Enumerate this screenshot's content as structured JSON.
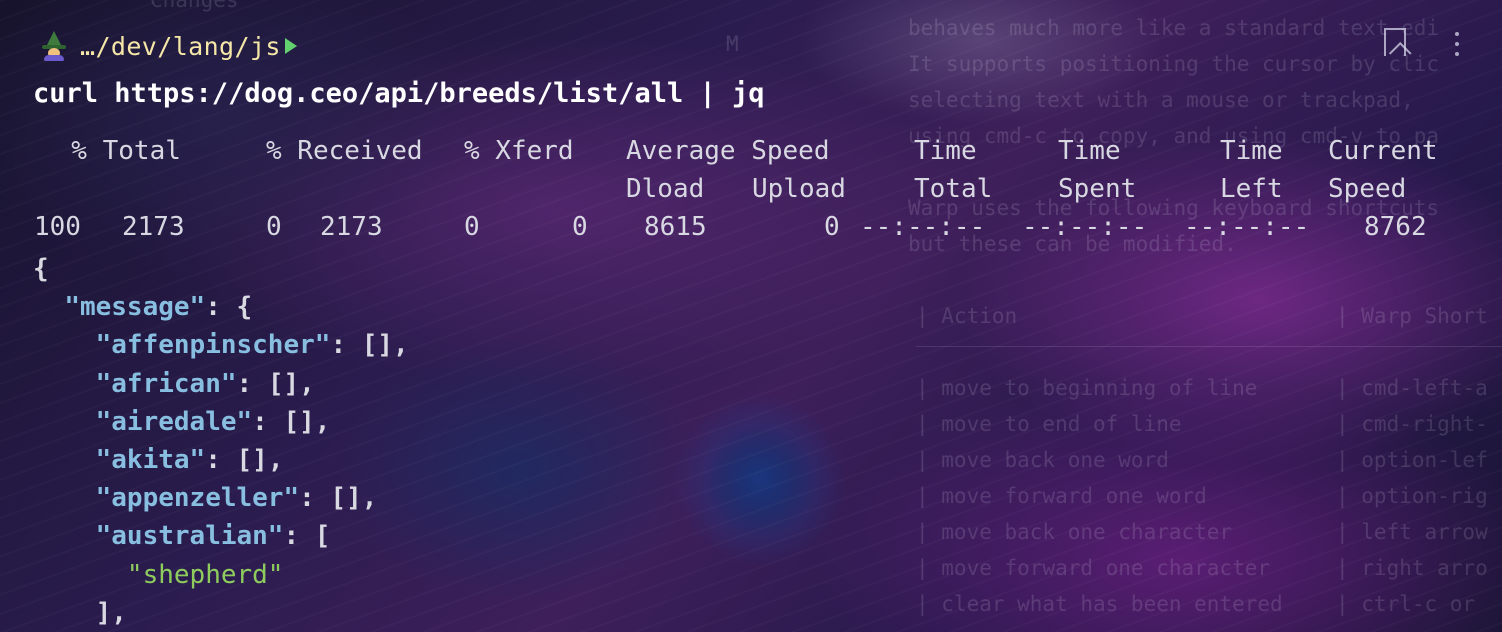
{
  "prompt": {
    "path": "…/dev/lang/js"
  },
  "command": "curl https://dog.ceo/api/breeds/list/all | jq",
  "progress": {
    "headers_row1": [
      {
        "text": "  % Total"
      },
      {
        "text": "% Received"
      },
      {
        "text": "% Xferd"
      },
      {
        "text": "Average Speed"
      },
      {
        "text": "Time"
      },
      {
        "text": "Time"
      },
      {
        "text": "Time"
      },
      {
        "text": "Current"
      }
    ],
    "headers_row2": [
      {
        "text": "Dload"
      },
      {
        "text": "Upload"
      },
      {
        "text": "Total"
      },
      {
        "text": "Spent"
      },
      {
        "text": "Left"
      },
      {
        "text": "Speed"
      }
    ],
    "values": [
      {
        "text": "100"
      },
      {
        "text": "2173"
      },
      {
        "text": "0"
      },
      {
        "text": "2173"
      },
      {
        "text": "0"
      },
      {
        "text": "0"
      },
      {
        "text": "8615"
      },
      {
        "text": "0"
      },
      {
        "text": "--:--:--"
      },
      {
        "text": "--:--:--"
      },
      {
        "text": "--:--:--"
      },
      {
        "text": "8762"
      }
    ]
  },
  "json_output": {
    "open_brace": "{",
    "message_key": "\"message\"",
    "message_colon": ": {",
    "entries": [
      {
        "key": "\"affenpinscher\"",
        "rest": ": [],"
      },
      {
        "key": "\"african\"",
        "rest": ": [],"
      },
      {
        "key": "\"airedale\"",
        "rest": ": [],"
      },
      {
        "key": "\"akita\"",
        "rest": ": [],"
      },
      {
        "key": "\"appenzeller\"",
        "rest": ": [],"
      }
    ],
    "australian_key": "\"australian\"",
    "australian_rest": ": [",
    "shepherd": "\"shepherd\"",
    "close_array": "],"
  },
  "background_text": {
    "top_label": "Changes",
    "m_label": "M",
    "line1": "behaves much more like a standard text edi",
    "line2": "It supports positioning the cursor by clic",
    "line3": "selecting text with a mouse or trackpad,",
    "line4": "using cmd-c to copy, and using cmd-v to pa",
    "line5": "Warp uses the following keyboard shortcuts",
    "line6": "but these can be modified.",
    "table_header_action": "| Action",
    "table_header_warp": "| Warp Short",
    "rows": [
      {
        "action": "| move to beginning of line",
        "shortcut": "| cmd-left-a"
      },
      {
        "action": "| move to end of line",
        "shortcut": "| cmd-right-"
      },
      {
        "action": "| move back one word",
        "shortcut": "| option-lef"
      },
      {
        "action": "| move forward one word",
        "shortcut": "| option-rig"
      },
      {
        "action": "| move back one character",
        "shortcut": "| left arrow"
      },
      {
        "action": "| move forward one character",
        "shortcut": "| right arro"
      },
      {
        "action": "| clear what has been entered",
        "shortcut": "| ctrl-c or "
      }
    ]
  },
  "colors": {
    "path": "#f5e7a8",
    "prompt_arrow": "#62d26f",
    "json_key": "#88bfe0",
    "json_string": "#8fcc5e",
    "text": "#d9d9e2"
  }
}
